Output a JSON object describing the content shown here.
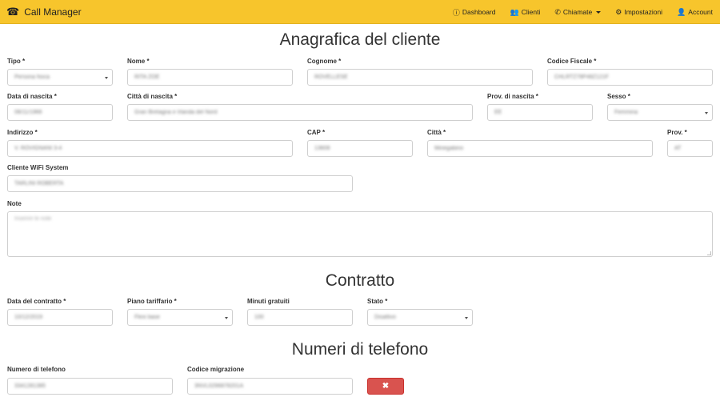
{
  "app": {
    "title": "Call Manager",
    "icon": "phone-icon"
  },
  "nav": {
    "dashboard": "Dashboard",
    "clienti": "Clienti",
    "chiamate": "Chiamate",
    "impostazioni": "Impostazioni",
    "account": "Account"
  },
  "anagrafica": {
    "title": "Anagrafica del cliente",
    "tipo": {
      "label": "Tipo *",
      "value": "Persona fisica"
    },
    "nome": {
      "label": "Nome *",
      "value": "RITA ZOE"
    },
    "cognome": {
      "label": "Cognome *",
      "value": "ROVELLESE"
    },
    "codice_fiscale": {
      "label": "Codice Fiscale *",
      "value": "CHLRTZ78P48Z121F"
    },
    "data_nascita": {
      "label": "Data di nascita *",
      "value": "08/11/1966"
    },
    "citta_nascita": {
      "label": "Città di nascita *",
      "value": "Gran Bretagna e Irlanda del Nord"
    },
    "prov_nascita": {
      "label": "Prov. di nascita *",
      "value": "EE"
    },
    "sesso": {
      "label": "Sesso *",
      "value": "Femmina"
    },
    "indirizzo": {
      "label": "Indirizzo *",
      "value": "V. ROVIGNANI 3-4"
    },
    "cap": {
      "label": "CAP *",
      "value": "13608"
    },
    "citta": {
      "label": "Città *",
      "value": "Minegabino"
    },
    "prov": {
      "label": "Prov. *",
      "value": "AT"
    },
    "wifi": {
      "label": "Cliente WiFi System",
      "value": "TARLINI ROBERTA"
    },
    "note": {
      "label": "Note",
      "placeholder": "Inserire le note"
    }
  },
  "contratto": {
    "title": "Contratto",
    "data_contratto": {
      "label": "Data del contratto *",
      "value": "10/12/2019"
    },
    "piano": {
      "label": "Piano tariffario *",
      "value": "Flexi base"
    },
    "minuti": {
      "label": "Minuti gratuiti",
      "value": "100"
    },
    "stato": {
      "label": "Stato *",
      "value": "Disattivo"
    }
  },
  "numeri": {
    "title": "Numeri di telefono",
    "numero": {
      "label": "Numero di telefono",
      "value": "3341281385"
    },
    "migrazione": {
      "label": "Codice migrazione",
      "value": "3NVL0296878201A"
    },
    "delete_button": "✖"
  }
}
